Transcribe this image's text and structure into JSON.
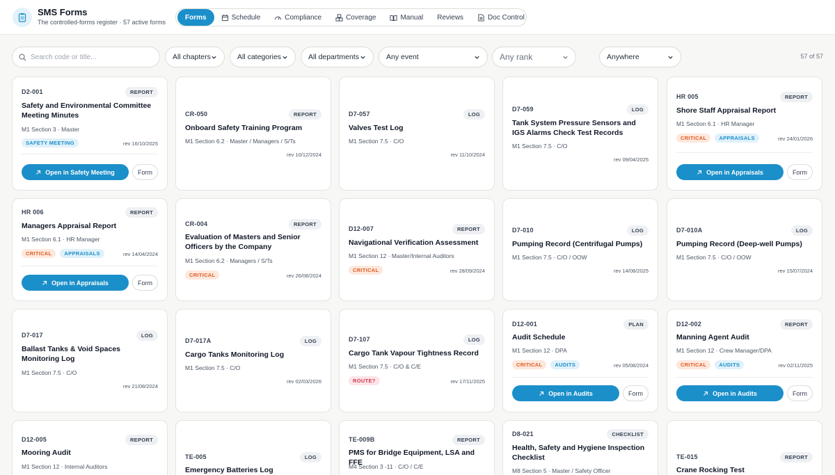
{
  "app": {
    "title": "SMS Forms",
    "subtitle": "The controlled-forms register · 57 active forms"
  },
  "nav": {
    "forms": "Forms",
    "schedule": "Schedule",
    "compliance": "Compliance",
    "coverage": "Coverage",
    "manual": "Manual",
    "reviews": "Reviews",
    "doc_control": "Doc Control"
  },
  "filters": {
    "search_placeholder": "Search code or title...",
    "chapters": "All chapters",
    "categories": "All categories",
    "departments": "All departments",
    "event": "Any event",
    "rank": "Any rank",
    "location": "Anywhere",
    "count": "57 of 57"
  },
  "icons": {
    "logo": "clipboard-icon",
    "search": "search-icon",
    "chevron": "chevron-down-icon",
    "open": "arrow-up-right-icon"
  },
  "colors": {
    "accent": "#1b8fc9",
    "critical": "#e05d22",
    "route": "#d33a56"
  },
  "cards": [
    {
      "code": "D2-001",
      "type": "REPORT",
      "title": "Safety and Environmental Committee Meeting Minutes",
      "meta": "M1 Section 3 · Master",
      "tags": [
        "SAFETY MEETING"
      ],
      "rev": "rev 16/10/2025",
      "open": "Open in Safety Meeting",
      "form": "Form"
    },
    {
      "code": "CR-050",
      "type": "REPORT",
      "title": "Onboard Safety Training Program",
      "meta": "M1 Section 6.2 · Master / Managers / S/Ts",
      "rev": "rev 10/12/2024"
    },
    {
      "code": "D7-057",
      "type": "LOG",
      "title": "Valves Test Log",
      "meta": "M1 Section 7.5 · C/O",
      "rev": "rev 11/10/2024"
    },
    {
      "code": "D7-059",
      "type": "LOG",
      "title": "Tank System Pressure Sensors and IGS Alarms Check Test Records",
      "meta": "M1 Section 7.5 · C/O",
      "rev": "rev 09/04/2025"
    },
    {
      "code": "HR 005",
      "type": "REPORT",
      "title": "Shore Staff Appraisal Report",
      "meta": "M1 Section 6.1 · HR Manager",
      "tags": [
        "CRITICAL",
        "APPRAISALS"
      ],
      "rev": "rev 24/01/2026",
      "open": "Open in Appraisals",
      "form": "Form"
    },
    {
      "code": "HR 006",
      "type": "REPORT",
      "title": "Managers Appraisal Report",
      "meta": "M1 Section 6.1 · HR Manager",
      "tags": [
        "CRITICAL",
        "APPRAISALS"
      ],
      "rev": "rev 14/04/2024",
      "open": "Open in Appraisals",
      "form": "Form"
    },
    {
      "code": "CR-004",
      "type": "REPORT",
      "title": "Evaluation of Masters and Senior Officers by the Company",
      "meta": "M1 Section 6.2 · Managers / S/Ts",
      "tags": [
        "CRITICAL"
      ],
      "rev": "rev 26/08/2024"
    },
    {
      "code": "D12-007",
      "type": "REPORT",
      "title": "Navigational Verification Assessment",
      "meta": "M1 Section 12 · Master/Internal Auditors",
      "tags": [
        "CRITICAL"
      ],
      "rev": "rev 28/09/2024"
    },
    {
      "code": "D7-010",
      "type": "LOG",
      "title": "Pumping Record (Centrifugal Pumps)",
      "meta": "M1 Section 7.5 · C/O / OOW",
      "rev": "rev 14/08/2025"
    },
    {
      "code": "D7-010A",
      "type": "LOG",
      "title": "Pumping Record (Deep-well Pumps)",
      "meta": "M1 Section 7.5 · C/O / OOW",
      "rev": "rev 15/07/2024"
    },
    {
      "code": "D7-017",
      "type": "LOG",
      "title": "Ballast Tanks & Void Spaces Monitoring Log",
      "meta": "M1 Section 7.5 · C/O",
      "rev": "rev 21/08/2024"
    },
    {
      "code": "D7-017A",
      "type": "LOG",
      "title": "Cargo Tanks Monitoring Log",
      "meta": "M1 Section 7.5 · C/O",
      "rev": "rev 02/03/2026"
    },
    {
      "code": "D7-107",
      "type": "LOG",
      "title": "Cargo Tank Vapour Tightness Record",
      "meta": "M1 Section 7.5 · C/O & C/E",
      "tags": [
        "ROUTE?"
      ],
      "rev": "rev 17/11/2025"
    },
    {
      "code": "D12-001",
      "type": "PLAN",
      "title": "Audit Schedule",
      "meta": "M1 Section 12 · DPA",
      "tags": [
        "CRITICAL",
        "AUDITS"
      ],
      "rev": "rev 05/08/2024",
      "open": "Open in Audits",
      "form": "Form"
    },
    {
      "code": "D12-002",
      "type": "REPORT",
      "title": "Manning Agent Audit",
      "meta": "M1 Section 12 · Crew Manager/DPA",
      "tags": [
        "CRITICAL",
        "AUDITS"
      ],
      "rev": "rev 02/11/2025",
      "open": "Open in Audits",
      "form": "Form"
    },
    {
      "code": "D12-005",
      "type": "REPORT",
      "title": "Mooring Audit",
      "meta": "M1 Section 12 · Internal Auditors"
    },
    {
      "code": "TE-005",
      "type": "LOG",
      "title": "Emergency Batteries Log"
    },
    {
      "code": "TE-009B",
      "type": "REPORT",
      "title": "PMS for Bridge Equipment, LSA and FFE",
      "meta": "M4 Section 3 -11 · C/O / C/E"
    },
    {
      "code": "D8-021",
      "type": "CHECKLIST",
      "title": "Health, Safety and Hygiene Inspection Checklist",
      "meta": "M8 Section 5 · Master / Safety Officer"
    },
    {
      "code": "TE-015",
      "type": "REPORT",
      "title": "Crane Rocking Test"
    }
  ]
}
